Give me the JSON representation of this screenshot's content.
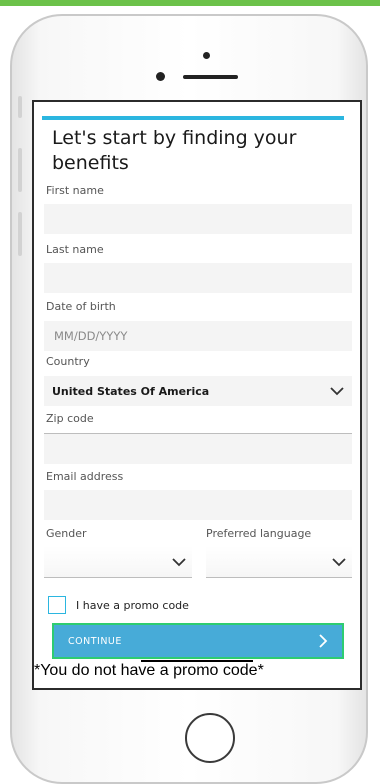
{
  "form": {
    "title": "Let's start by finding your benefits",
    "first_name": {
      "label": "First name",
      "value": ""
    },
    "last_name": {
      "label": "Last name",
      "value": ""
    },
    "date_of_birth": {
      "label": "Date of birth",
      "placeholder": "MM/DD/YYYY",
      "value": ""
    },
    "country": {
      "label": "Country",
      "value": "United States Of America"
    },
    "zip_code": {
      "label": "Zip code",
      "value": ""
    },
    "email": {
      "label": "Email address",
      "value": ""
    },
    "gender": {
      "label": "Gender",
      "value": ""
    },
    "preferred_language": {
      "label": "Preferred language",
      "value": ""
    },
    "promo_checkbox": {
      "label": "I have a promo code",
      "checked": false
    },
    "continue_label": "CONTINUE"
  },
  "annotation": "*You do not have a promo code*",
  "colors": {
    "accent": "#2bb6e0",
    "button": "#47abd8",
    "highlight_border": "#2ecc71",
    "top_bar": "#6cc24a"
  },
  "icons": {
    "dropdown": "chevron-down-icon",
    "continue": "chevron-right-icon"
  }
}
